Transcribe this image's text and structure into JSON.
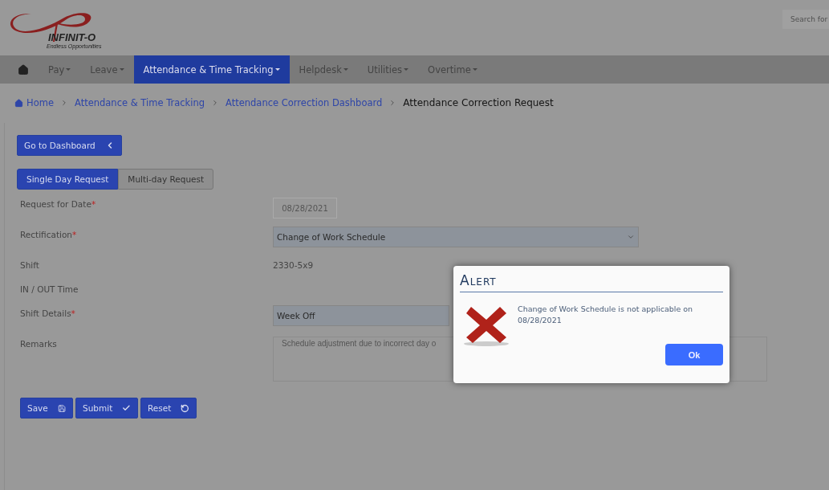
{
  "header": {
    "logo_name": "INFINIT-O",
    "logo_tagline": "Endless Opportunities",
    "search": {
      "placeholder": "Search for"
    }
  },
  "nav": {
    "items": [
      {
        "label": "Pay",
        "selected": false
      },
      {
        "label": "Leave",
        "selected": false
      },
      {
        "label": "Attendance & Time Tracking",
        "selected": true
      },
      {
        "label": "Helpdesk",
        "selected": false
      },
      {
        "label": "Utilities",
        "selected": false
      },
      {
        "label": "Overtime",
        "selected": false
      }
    ]
  },
  "breadcrumb": {
    "links": [
      "Home",
      "Attendance & Time Tracking",
      "Attendance Correction Dashboard"
    ],
    "current": "Attendance Correction Request"
  },
  "dashboard_button": "Go to Dashboard",
  "request_tabs": [
    {
      "label": "Single Day Request",
      "selected": true
    },
    {
      "label": "Multi-day Request",
      "selected": false
    }
  ],
  "form": [
    {
      "kind": "date",
      "label": "Request for Date",
      "required_mark": "*",
      "value": "08/28/2021"
    },
    {
      "kind": "select",
      "label": "Rectification",
      "required_mark": "*",
      "value": "Change of Work Schedule"
    },
    {
      "kind": "text",
      "label": "Shift",
      "value": "2330-5x9"
    },
    {
      "kind": "text",
      "label": "IN / OUT Time"
    },
    {
      "kind": "select",
      "label": "Shift Details",
      "required_mark": "*",
      "value": "Week Off"
    },
    {
      "kind": "textarea",
      "label": "Remarks",
      "value": "Schedule adjustment due to incorrect day o"
    }
  ],
  "actions": [
    "Save",
    "Submit",
    "Reset"
  ],
  "alert": {
    "title": "Alert",
    "message": "Change of Work Schedule is not applicable on 08/28/2021",
    "button": "Ok"
  }
}
